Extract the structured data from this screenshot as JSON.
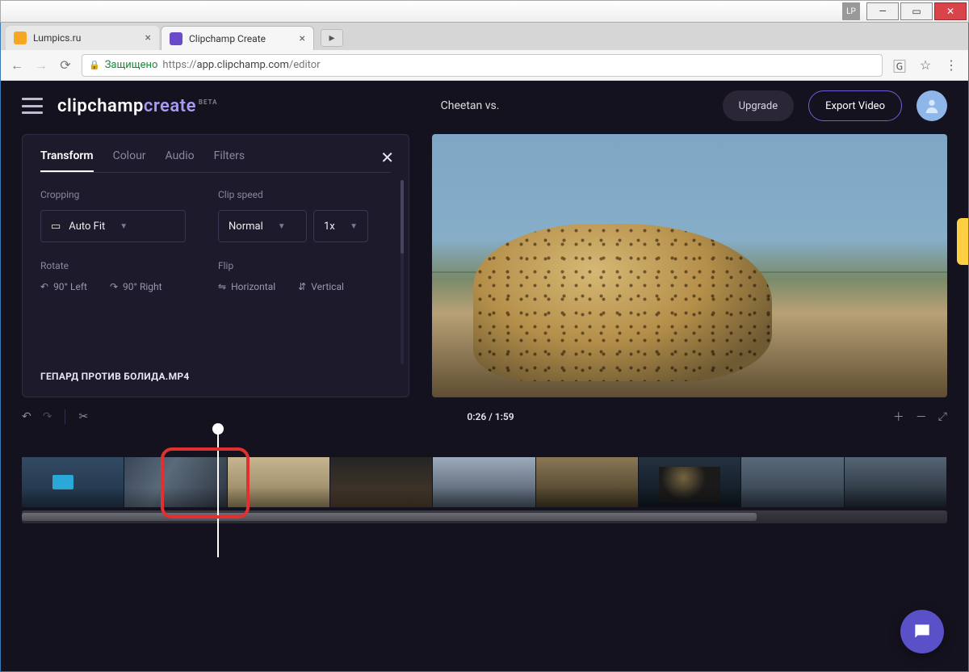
{
  "window": {
    "badge": "LP"
  },
  "browser": {
    "tabs": [
      {
        "title": "Lumpics.ru",
        "active": false
      },
      {
        "title": "Clipchamp Create",
        "active": true
      }
    ],
    "secure_label": "Защищено",
    "url_prefix": "https://",
    "url_host": "app.clipchamp.com",
    "url_path": "/editor"
  },
  "app": {
    "logo_part1": "clipchamp",
    "logo_part2": "create",
    "logo_badge": "BETA",
    "project_title": "Cheetan vs.",
    "upgrade_label": "Upgrade",
    "export_label": "Export Video"
  },
  "panel": {
    "tabs": {
      "transform": "Transform",
      "colour": "Colour",
      "audio": "Audio",
      "filters": "Filters"
    },
    "cropping_label": "Cropping",
    "cropping_value": "Auto Fit",
    "clipspeed_label": "Clip speed",
    "clipspeed_value": "Normal",
    "clipspeed_mult": "1x",
    "rotate_label": "Rotate",
    "rotate_left": "90° Left",
    "rotate_right": "90° Right",
    "flip_label": "Flip",
    "flip_h": "Horizontal",
    "flip_v": "Vertical",
    "filename": "ГЕПАРД ПРОТИВ БОЛИДА.MP4"
  },
  "timeline": {
    "time": "0:26 / 1:59"
  }
}
